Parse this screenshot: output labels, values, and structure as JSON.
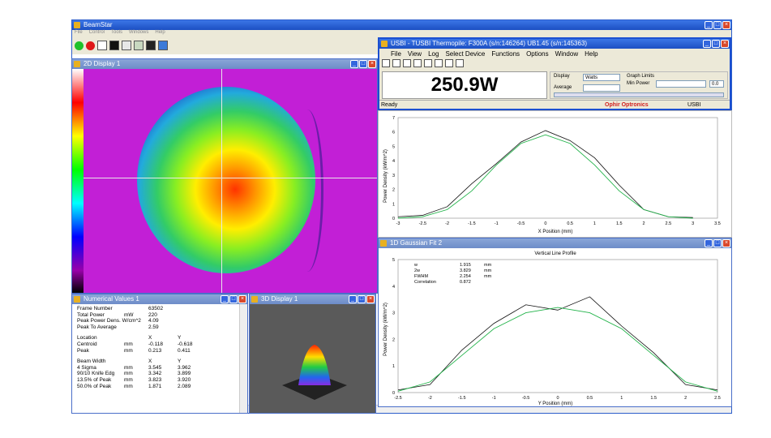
{
  "main": {
    "title": "BeamStar",
    "menu": [
      "File",
      "Control",
      "Tools",
      "Windows",
      "Help"
    ]
  },
  "display2d": {
    "title": "2D Display 1"
  },
  "usbi": {
    "title": "USBI - TUSBI Thermopile: F300A (s/n:146264)  UB1.45 (s/n:145363)",
    "menu": [
      "File",
      "View",
      "Log",
      "Select Device",
      "Functions",
      "Options",
      "Window",
      "Help"
    ],
    "reading": "250.9W",
    "display_label": "Display",
    "display_value": "Watts",
    "average_label": "Average",
    "graph_limits_label": "Graph Limits",
    "min_power_label": "Min Power",
    "min_power_value": "0.0",
    "status": "Ready",
    "brand": "Ophir Optronics",
    "port": "USBI"
  },
  "graph1": {
    "ylabel": "Power Density (kW/m^2)",
    "xlabel": "X Position (mm)"
  },
  "gauss": {
    "title": "1D Gaussian Fit 2",
    "subtitle": "Vertical Line Profile",
    "ylabel": "Power Density (kW/m^2)",
    "xlabel": "Y Position (mm)",
    "stats": [
      {
        "k": "w",
        "v": "1.915",
        "u": "mm"
      },
      {
        "k": "2w",
        "v": "3.829",
        "u": "mm"
      },
      {
        "k": "FWHM",
        "v": "2.254",
        "u": "mm"
      },
      {
        "k": "Correlation",
        "v": "0.872",
        "u": ""
      }
    ]
  },
  "numeric": {
    "title": "Numerical Values 1",
    "frame_number_label": "Frame Number",
    "frame_number": "63502",
    "total_power_label": "Total Power",
    "total_power_unit": "mW",
    "total_power": "220",
    "peak_density_label": "Peak Power Dens. W/cm^2",
    "peak_density": "4.09",
    "peak_to_avg_label": "Peak To Average",
    "peak_to_avg": "2.59",
    "location_label": "Location",
    "x_label": "X",
    "y_label": "Y",
    "centroid_label": "Centroid",
    "centroid_unit": "mm",
    "centroid_x": "-0.118",
    "centroid_y": "-0.618",
    "peak_label": "Peak",
    "peak_unit": "mm",
    "peak_x": "0.213",
    "peak_y": "0.411",
    "beam_width_label": "Beam Width",
    "bw_rows": [
      {
        "label": "4 Sigma",
        "unit": "mm",
        "x": "3.545",
        "y": "3.962"
      },
      {
        "label": "90/10  Knife Edg",
        "unit": "mm",
        "x": "3.342",
        "y": "3.899"
      },
      {
        "label": "13.5% of Peak",
        "unit": "mm",
        "x": "3.823",
        "y": "3.920"
      },
      {
        "label": "50.0% of Peak",
        "unit": "mm",
        "x": "1.871",
        "y": "2.089"
      }
    ]
  },
  "display3d": {
    "title": "3D Display 1"
  },
  "chart_data": [
    {
      "type": "line",
      "title": "",
      "xlabel": "X Position (mm)",
      "ylabel": "Power Density (kW/m^2)",
      "xlim": [
        -3,
        3.5
      ],
      "ylim": [
        0,
        7
      ],
      "x_ticks": [
        "-3",
        "-2.5",
        "-2",
        "-1.5",
        "-1",
        "-0.5",
        "0",
        "0.5",
        "1",
        "1.5",
        "2",
        "2.5",
        "3",
        "3.5"
      ],
      "y_ticks": [
        "0",
        "1",
        "2",
        "3",
        "4",
        "5",
        "6",
        "7"
      ],
      "series": [
        {
          "x": [
            -3,
            -2.5,
            -2,
            -1.5,
            -1,
            -0.5,
            0,
            0.5,
            1,
            1.5,
            2,
            2.5,
            3
          ],
          "values": [
            0.1,
            0.2,
            0.8,
            2.4,
            3.8,
            5.3,
            6.1,
            5.4,
            4.2,
            2.3,
            0.6,
            0.1,
            0.05
          ]
        },
        {
          "x": [
            -3,
            -2.5,
            -2,
            -1.5,
            -1,
            -0.5,
            0,
            0.5,
            1,
            1.5,
            2,
            2.5,
            3
          ],
          "values": [
            0.0,
            0.1,
            0.6,
            1.9,
            3.7,
            5.2,
            5.8,
            5.2,
            3.7,
            1.9,
            0.6,
            0.1,
            0.0
          ]
        }
      ]
    },
    {
      "type": "line",
      "title": "Vertical Line Profile",
      "xlabel": "Y Position (mm)",
      "ylabel": "Power Density (kW/m^2)",
      "xlim": [
        -2.5,
        2.5
      ],
      "ylim": [
        0,
        5
      ],
      "x_ticks": [
        "-2.5",
        "-2",
        "-1.5",
        "-1",
        "-0.5",
        "0",
        "0.5",
        "1",
        "1.5",
        "2",
        "2.5"
      ],
      "y_ticks": [
        "0",
        "1",
        "2",
        "3",
        "4",
        "5"
      ],
      "series": [
        {
          "x": [
            -2.5,
            -2,
            -1.5,
            -1,
            -0.5,
            0,
            0.5,
            1,
            1.5,
            2,
            2.5
          ],
          "values": [
            0.1,
            0.3,
            1.6,
            2.6,
            3.3,
            3.1,
            3.6,
            2.5,
            1.5,
            0.3,
            0.1
          ]
        },
        {
          "x": [
            -2.5,
            -2,
            -1.5,
            -1,
            -0.5,
            0,
            0.5,
            1,
            1.5,
            2,
            2.5
          ],
          "values": [
            0.05,
            0.4,
            1.4,
            2.4,
            3.0,
            3.2,
            3.0,
            2.4,
            1.4,
            0.4,
            0.05
          ]
        }
      ]
    }
  ]
}
